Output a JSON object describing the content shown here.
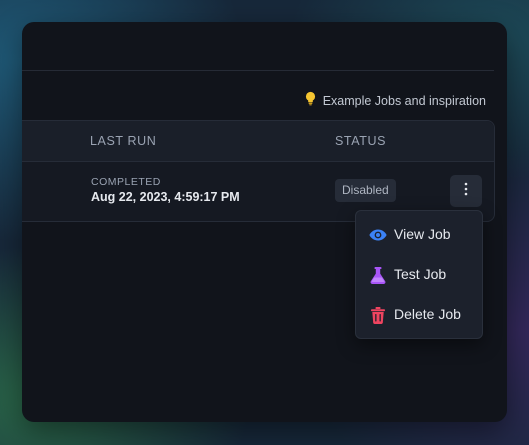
{
  "hint": {
    "label": "Example Jobs and inspiration",
    "icon": "lightbulb-icon",
    "icon_color": "#f5c531"
  },
  "table": {
    "columns": [
      "LAST RUN",
      "STATUS"
    ],
    "rows": [
      {
        "run_status": "COMPLETED",
        "run_date": "Aug 22, 2023, 4:59:17 PM",
        "status": "Disabled",
        "actions_icon": "more-vertical-icon"
      }
    ]
  },
  "menu": {
    "items": [
      {
        "label": "View Job",
        "icon": "eye-icon",
        "color": "#3b82f6"
      },
      {
        "label": "Test Job",
        "icon": "flask-icon",
        "color": "#a855f7"
      },
      {
        "label": "Delete Job",
        "icon": "trash-icon",
        "color": "#ef4460"
      }
    ]
  }
}
